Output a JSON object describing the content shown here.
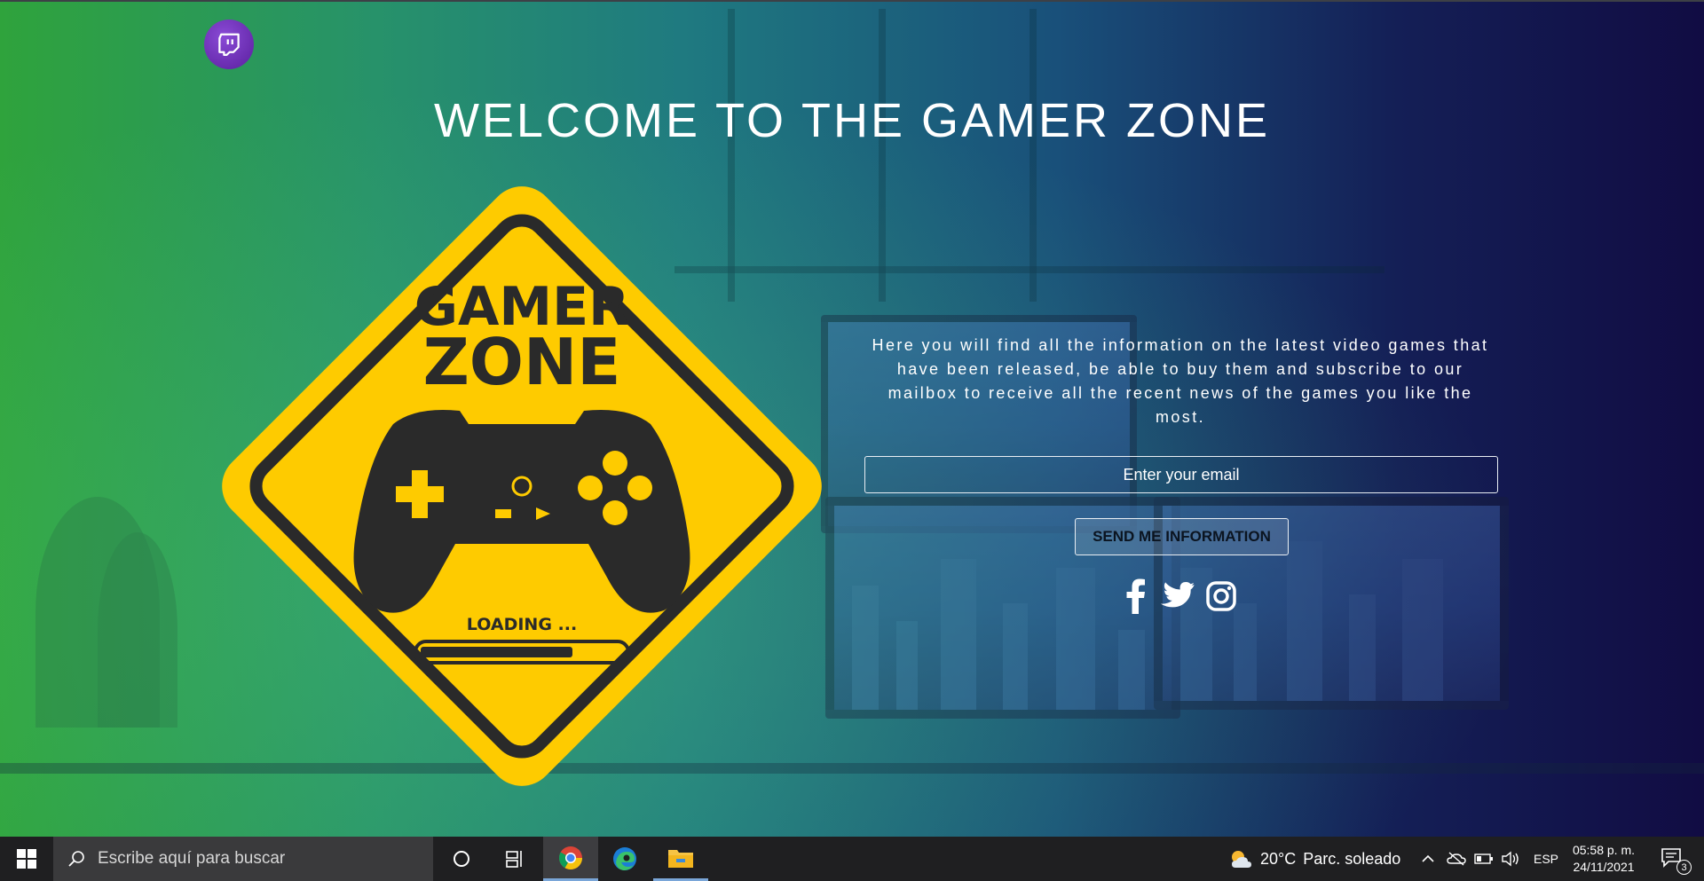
{
  "page": {
    "title": "WELCOME TO THE GAMER ZONE",
    "sign": {
      "line1": "GAMER",
      "line2": "ZONE",
      "loading_label": "LOADING ...",
      "loading_progress": 0.75,
      "colors": {
        "yellow": "#FECB00",
        "dark": "#2A2A2A"
      }
    },
    "description": "Here you will find all the information on the latest video games that have been released, be able to buy them and subscribe to our mailbox to receive all the recent news of the games you like the most.",
    "email_placeholder": "Enter your email",
    "send_button_label": "SEND ME INFORMATION",
    "social_icons": [
      "facebook-icon",
      "twitter-icon",
      "instagram-icon"
    ],
    "logo_icon": "twitch-icon",
    "colors": {
      "gradient_left": "#2FA33C",
      "gradient_right": "#110C43",
      "twitch_purple": "#6A2BC0"
    }
  },
  "taskbar": {
    "search_placeholder": "Escribe aquí para buscar",
    "weather": {
      "temperature": "20°C",
      "condition": "Parc. soleado"
    },
    "language": "ESP",
    "time": "05:58 p. m.",
    "date": "24/11/2021",
    "notification_count": "3",
    "pinned_apps": [
      "chrome-icon",
      "edge-icon",
      "file-explorer-icon"
    ]
  }
}
